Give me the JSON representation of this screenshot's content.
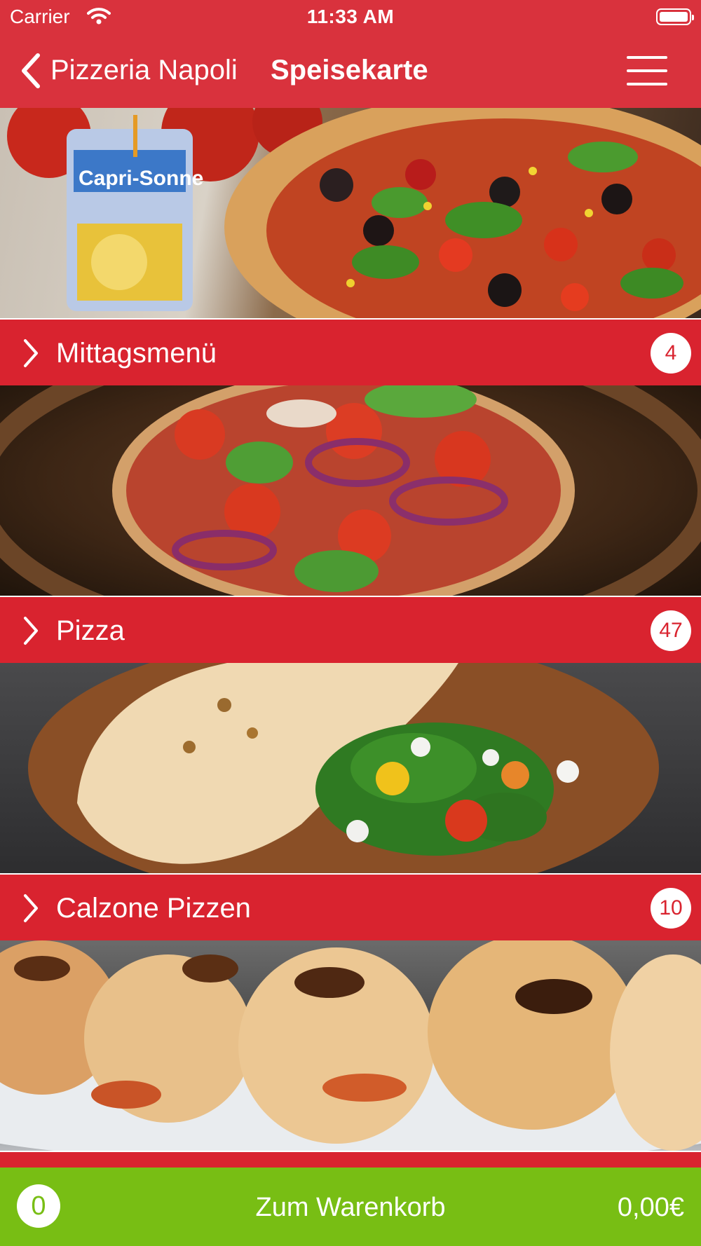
{
  "status_bar": {
    "carrier": "Carrier",
    "time": "11:33 AM"
  },
  "nav": {
    "back_label": "Pizzeria Napoli",
    "title": "Speisekarte"
  },
  "categories": [
    {
      "label": "Mittagsmenü",
      "count": "4"
    },
    {
      "label": "Pizza",
      "count": "47"
    },
    {
      "label": "Calzone Pizzen",
      "count": "10"
    }
  ],
  "cart": {
    "count": "0",
    "label": "Zum Warenkorb",
    "total": "0,00€"
  },
  "colors": {
    "header": "#d9323d",
    "category_bar": "#d9232f",
    "cart": "#78be14"
  },
  "icons": {
    "back": "chevron-left-icon",
    "menu": "hamburger-icon",
    "category": "chevron-right-icon",
    "wifi": "wifi-icon",
    "battery": "battery-icon"
  }
}
